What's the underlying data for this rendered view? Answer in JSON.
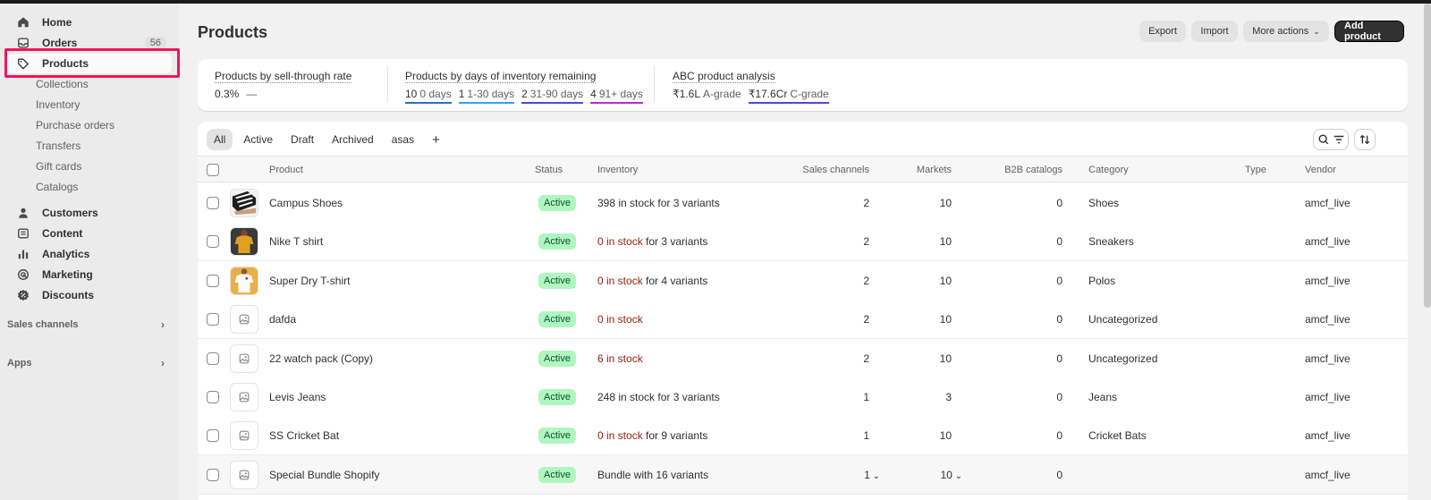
{
  "sidebar": {
    "items": [
      {
        "label": "Home"
      },
      {
        "label": "Orders",
        "badge": "56"
      },
      {
        "label": "Products"
      },
      {
        "label": "Customers"
      },
      {
        "label": "Content"
      },
      {
        "label": "Analytics"
      },
      {
        "label": "Marketing"
      },
      {
        "label": "Discounts"
      }
    ],
    "product_sub": [
      "Collections",
      "Inventory",
      "Purchase orders",
      "Transfers",
      "Gift cards",
      "Catalogs"
    ],
    "sections": [
      "Sales channels",
      "Apps"
    ]
  },
  "header": {
    "title": "Products",
    "export_label": "Export",
    "import_label": "Import",
    "more_label": "More actions",
    "add_label": "Add product"
  },
  "metrics": {
    "sell_through": {
      "title": "Products by sell-through rate",
      "value": "0.3%",
      "trend": "—"
    },
    "days_inventory": {
      "title": "Products by days of inventory remaining",
      "segments": [
        {
          "num": "10",
          "label": "0 days",
          "color": "#2c6ecb"
        },
        {
          "num": "1",
          "label": "1-30 days",
          "color": "#36a2eb"
        },
        {
          "num": "2",
          "label": "31-90 days",
          "color": "#4f46e5"
        },
        {
          "num": "4",
          "label": "91+ days",
          "color": "#c026d3"
        }
      ]
    },
    "abc": {
      "title": "ABC product analysis",
      "segments": [
        {
          "num": "₹1.6L",
          "label": "A-grade",
          "color": ""
        },
        {
          "num": "₹17.6Cr",
          "label": "C-grade",
          "color": "#4f46e5"
        }
      ]
    }
  },
  "tabs": [
    "All",
    "Active",
    "Draft",
    "Archived",
    "asas",
    "+"
  ],
  "table": {
    "columns": {
      "product": "Product",
      "status": "Status",
      "inventory": "Inventory",
      "sales_channels": "Sales channels",
      "markets": "Markets",
      "b2b": "B2B catalogs",
      "category": "Category",
      "type": "Type",
      "vendor": "Vendor"
    },
    "rows": [
      {
        "product": "Campus Shoes",
        "status": "Active",
        "inv_warn": "",
        "inv_rest": "398 in stock for 3 variants",
        "sales": "2",
        "markets": "10",
        "b2b": "0",
        "category": "Shoes",
        "vendor": "amcf_live",
        "thumb": "shoe"
      },
      {
        "product": "Nike T shirt",
        "status": "Active",
        "inv_warn": "0 in stock",
        "inv_rest": " for 3 variants",
        "sales": "2",
        "markets": "10",
        "b2b": "0",
        "category": "Sneakers",
        "vendor": "amcf_live",
        "thumb": "tshirt-dark"
      },
      {
        "product": "Super Dry T-shirt",
        "status": "Active",
        "inv_warn": "0 in stock",
        "inv_rest": " for 4 variants",
        "sales": "2",
        "markets": "10",
        "b2b": "0",
        "category": "Polos",
        "vendor": "amcf_live",
        "thumb": "tshirt-white"
      },
      {
        "product": "dafda",
        "status": "Active",
        "inv_warn": "0 in stock",
        "inv_rest": "",
        "sales": "2",
        "markets": "10",
        "b2b": "0",
        "category": "Uncategorized",
        "vendor": "amcf_live",
        "thumb": "placeholder"
      },
      {
        "product": "22 watch pack (Copy)",
        "status": "Active",
        "inv_warn": "6 in stock",
        "inv_rest": "",
        "sales": "2",
        "markets": "10",
        "b2b": "0",
        "category": "Uncategorized",
        "vendor": "amcf_live",
        "thumb": "placeholder"
      },
      {
        "product": "Levis Jeans",
        "status": "Active",
        "inv_warn": "",
        "inv_rest": "248 in stock for 3 variants",
        "sales": "1",
        "markets": "3",
        "b2b": "0",
        "category": "Jeans",
        "vendor": "amcf_live",
        "thumb": "placeholder"
      },
      {
        "product": "SS Cricket Bat",
        "status": "Active",
        "inv_warn": "0 in stock",
        "inv_rest": " for 9 variants",
        "sales": "1",
        "markets": "10",
        "b2b": "0",
        "category": "Cricket Bats",
        "vendor": "amcf_live",
        "thumb": "placeholder"
      },
      {
        "product": "Special Bundle Shopify",
        "status": "Active",
        "inv_warn": "",
        "inv_rest": "Bundle with 16 variants",
        "sales": "1",
        "markets": "10",
        "b2b": "0",
        "category": "",
        "vendor": "amcf_live",
        "thumb": "placeholder",
        "dropdowns": true
      }
    ]
  }
}
